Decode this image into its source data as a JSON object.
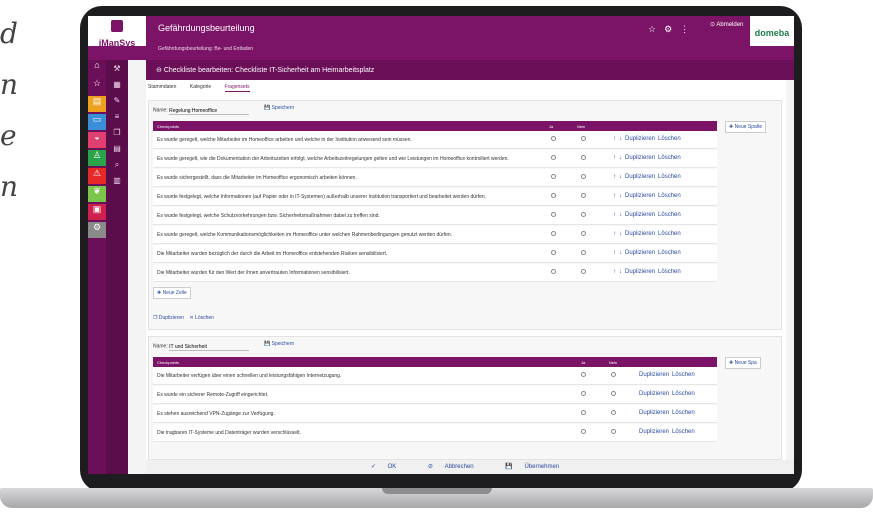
{
  "side_text": [
    "d",
    "n",
    "e",
    "n"
  ],
  "app": {
    "logo_text": "iManSys",
    "title": "Gefährdungsbeurteilung",
    "subtitle": "Gefährdungsbeurteilung: Be- und Entladen",
    "logout_label": "Abmelden",
    "brand": "domeba"
  },
  "page": {
    "header": "Checkliste bearbeiten: Checkliste IT-Sicherheit am Heimarbeitsplatz"
  },
  "tabs": [
    "Stammdaten",
    "Kategorie",
    "Fragensets"
  ],
  "set1": {
    "name_label": "Name:",
    "name_value": "Regelung Homeoffice",
    "save_label": "Speichern",
    "col_checkpoint": "Checkpoints",
    "col_ja": "Ja",
    "col_nein": "Nein",
    "new_col": "Neue Spalte",
    "new_row": "Neue Zeile",
    "rows": [
      "Es wurde geregelt, welche Mitarbeiter im Homeoffice arbeiten und welche in der Institution anwesend sein müssen.",
      "Es wurde geregelt, wie die Dokumentation der Arbeitszeiten erfolgt, welche Arbeitszeitregelungen gelten und wie Leistungen im Homeoffice kontrolliert werden.",
      "Es wurde sichergestellt, dass die Mitarbeiter im Homeoffice ergonomisch arbeiten können.",
      "Es wurde festgelegt, welche Informationen (auf Papier oder in IT-Systemen) außerhalb unserer Institution transportiert und bearbeitet werden dürfen.",
      "Es wurde festgelegt, welche Schutzvorkehrungen bzw. Sicherheitsmaßnahmen dabei zu treffen sind.",
      "Es wurde geregelt, welche Kommunikationsmöglichkeiten im Homeoffice unter welchen Rahmenbedingungen genutzt werden dürfen.",
      "Die Mitarbeiter wurden bezüglich der durch die Arbeit im Homeoffice entstehenden Risiken sensibilisiert.",
      "Die Mitarbeiter wurden für den Wert der ihnen anvertrauten Informationen sensibilisiert."
    ],
    "dup_label": "Duplizieren",
    "del_label": "Löschen"
  },
  "set2": {
    "name_label": "Name:",
    "name_value": "IT und Sicherheit",
    "save_label": "Speichern",
    "col_checkpoint": "Checkpoints",
    "col_ja": "Ja",
    "col_nein": "Nein",
    "new_col": "Neue Spa",
    "rows": [
      "Die Mitarbeiter verfügen über einen schnellen und leistungsfähigen Internetzugang.",
      "Es wurde ein sicherer Remote-Zugriff eingerichtet.",
      "Es stehen ausreichend VPN-Zugänge zur Verfügung.",
      "Die tragbaren IT-Systeme und Datenträger wurden verschlüsselt."
    ]
  },
  "row_controls": {
    "dup": "Duplizieren",
    "del": "Löschen"
  },
  "footer": {
    "ok": "OK",
    "cancel": "Abbrechen",
    "apply": "Übernehmen"
  }
}
